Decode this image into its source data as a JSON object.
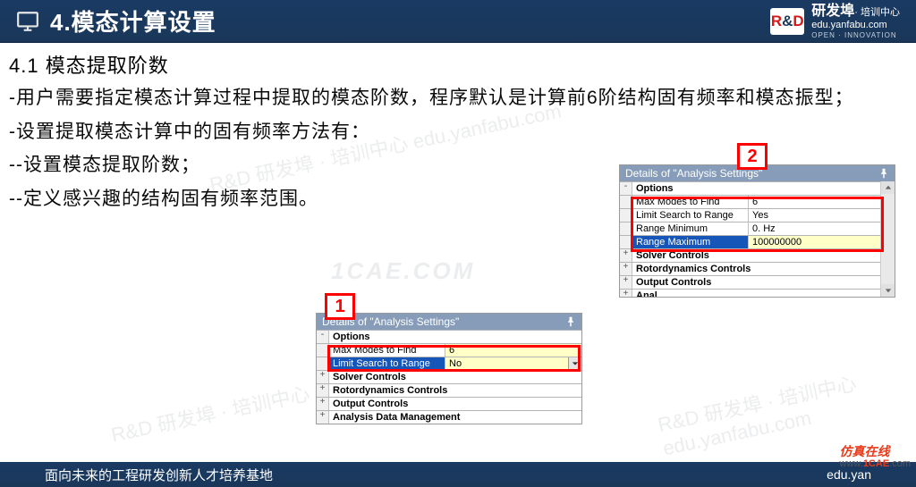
{
  "header": {
    "title": "4.模态计算设置",
    "brand_big": "研发埠",
    "brand_small": "· 培训中心",
    "brand_url": "edu.yanfabu.com",
    "brand_open": "OPEN · INNOVATION"
  },
  "section_label": "4.1 模态提取阶数",
  "paragraphs": {
    "p1": "-用户需要指定模态计算过程中提取的模态阶数，程序默认是计算前6阶结构固有频率和模态振型；",
    "p2": "-设置提取模态计算中的固有频率方法有：",
    "p3": "--设置模态提取阶数；",
    "p4": "--定义感兴趣的结构固有频率范围。"
  },
  "badge1": "1",
  "badge2": "2",
  "panel1": {
    "title": "Details of \"Analysis Settings\"",
    "rows": {
      "options": "Options",
      "maxmodes_k": "Max Modes to Find",
      "maxmodes_v": "6",
      "limit_k": "Limit Search to Range",
      "limit_v": "No",
      "solver": "Solver Controls",
      "rotor": "Rotordynamics Controls",
      "output": "Output Controls",
      "adm": "Analysis Data Management"
    }
  },
  "panel2": {
    "title": "Details of \"Analysis Settings\"",
    "rows": {
      "options": "Options",
      "maxmodes_k": "Max Modes to Find",
      "maxmodes_v": "6",
      "limit_k": "Limit Search to Range",
      "limit_v": "Yes",
      "rmin_k": "Range Minimum",
      "rmin_v": "0. Hz",
      "rmax_k": "Range Maximum",
      "rmax_v": "100000000",
      "solver": "Solver Controls",
      "rotor": "Rotordynamics Controls",
      "output": "Output Controls",
      "adm_prefix": "Analysis Data Management"
    }
  },
  "footer": {
    "left": "面向未来的工程研发创新人才培养基地",
    "right": "edu.yan"
  },
  "corner": {
    "line1": "仿真在线",
    "line2a": "www.",
    "line2b": "1CAE",
    "line2c": ".com"
  },
  "watermarks": {
    "center": "1CAE.COM",
    "diag": "R&D 研发埠 · 培训中心  edu.yanfabu.com"
  }
}
